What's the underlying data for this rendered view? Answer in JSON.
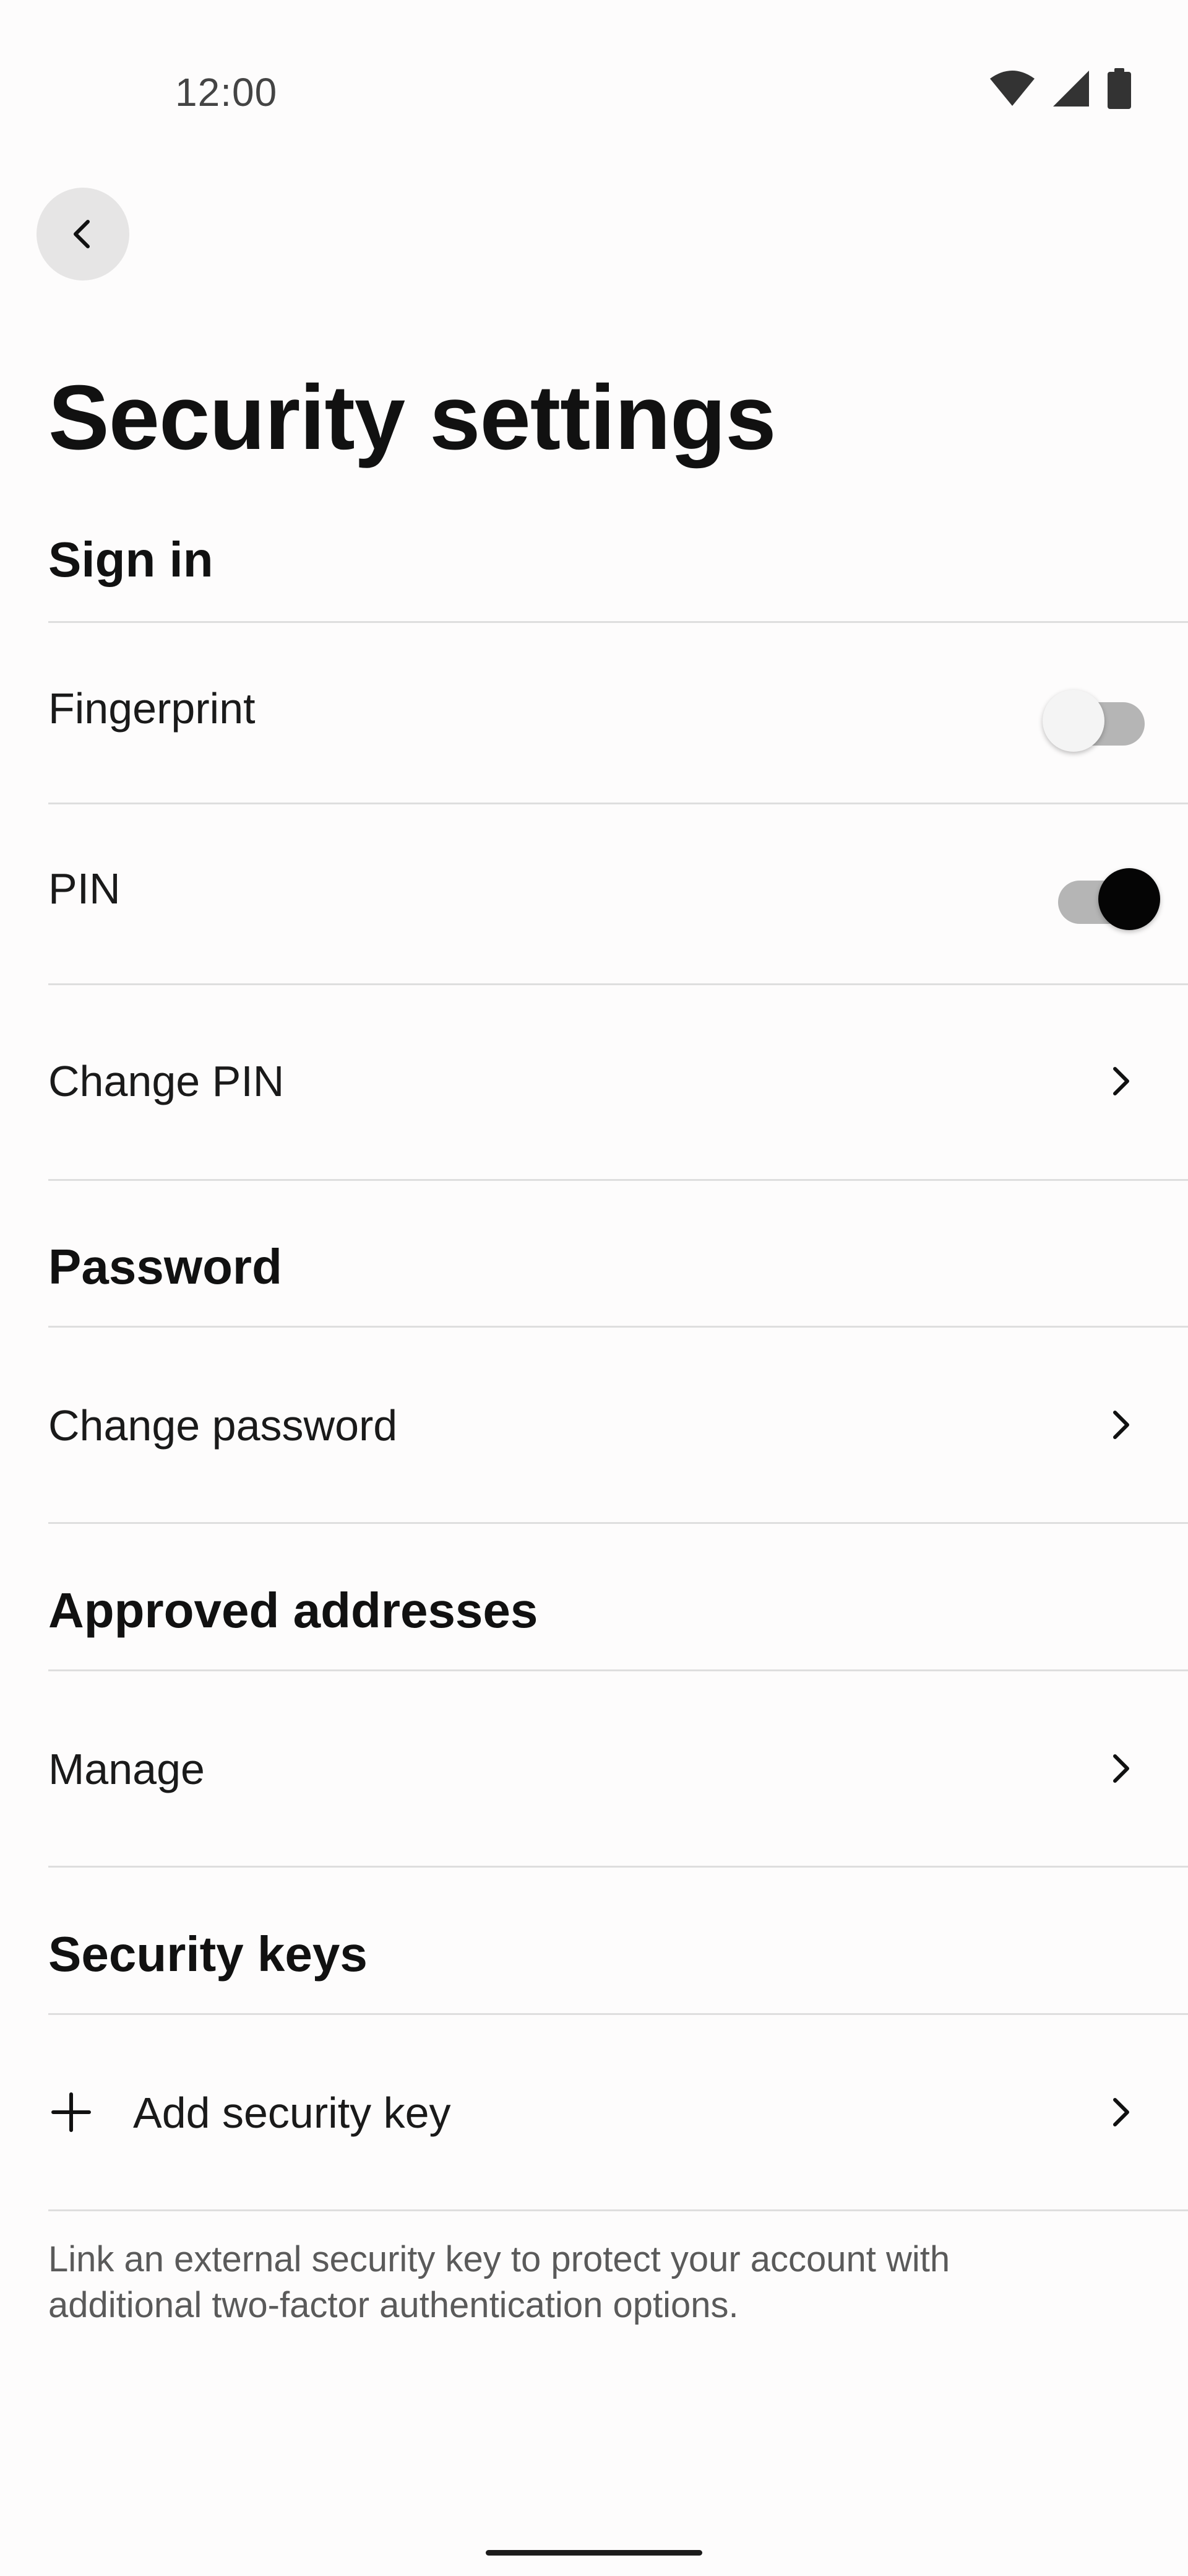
{
  "status_bar": {
    "time": "12:00",
    "icons": [
      "wifi-icon",
      "signal-icon",
      "battery-icon"
    ]
  },
  "header": {
    "back_icon": "chevron-left-icon",
    "title": "Security settings"
  },
  "sections": {
    "sign_in": {
      "header": "Sign in",
      "fingerprint": {
        "label": "Fingerprint",
        "enabled": false
      },
      "pin": {
        "label": "PIN",
        "enabled": true
      },
      "change_pin": {
        "label": "Change PIN"
      }
    },
    "password": {
      "header": "Password",
      "change_password": {
        "label": "Change password"
      }
    },
    "approved_addresses": {
      "header": "Approved addresses",
      "manage": {
        "label": "Manage"
      }
    },
    "security_keys": {
      "header": "Security keys",
      "add_key": {
        "label": "Add security key",
        "icon": "plus-icon"
      },
      "footnote": "Link an external security key to protect your account with additional two-factor authentication options."
    }
  },
  "colors": {
    "background": "#fdfcfc",
    "text": "#111111",
    "secondary_text": "#5a5a5a",
    "divider": "#dedede",
    "toggle_on_thumb": "#050505",
    "toggle_track": "#b5b5b5"
  }
}
